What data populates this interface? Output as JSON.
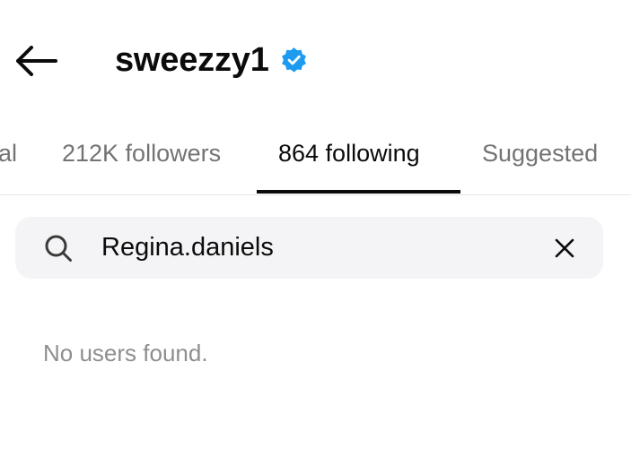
{
  "header": {
    "back_icon": "arrow-left-icon",
    "username": "sweezzy1",
    "verified_icon": "verified-badge-icon",
    "verified_color": "#1d9bf0"
  },
  "tabs": [
    {
      "label": "al",
      "active": false
    },
    {
      "label": "212K followers",
      "active": false
    },
    {
      "label": "864 following",
      "active": true
    },
    {
      "label": "Suggested",
      "active": false
    }
  ],
  "search": {
    "icon": "search-icon",
    "value": "Regina.daniels",
    "clear_icon": "close-icon"
  },
  "results": {
    "empty_message": "No users found."
  }
}
